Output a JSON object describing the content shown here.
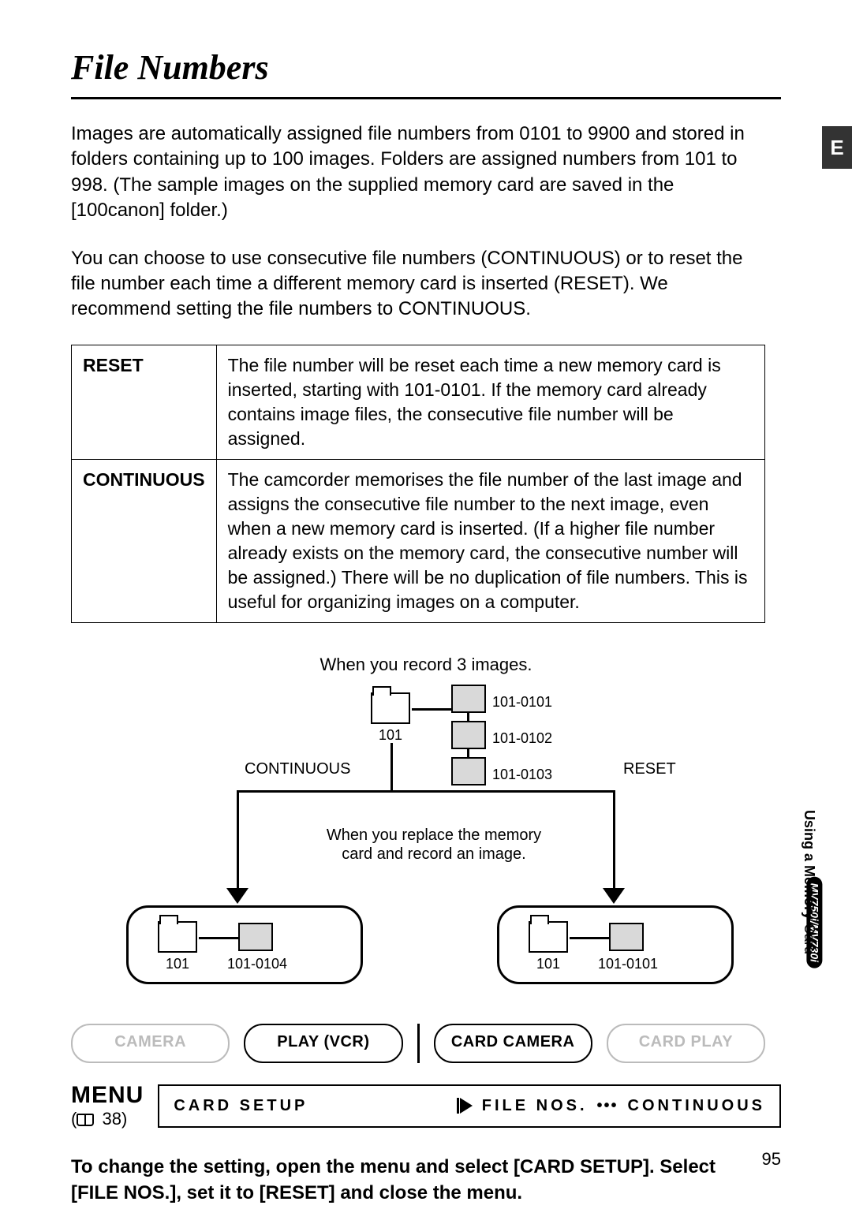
{
  "page": {
    "title": "File Numbers",
    "side_tab": "E",
    "page_number": "95",
    "side_section_bold": "Using a Memory ",
    "side_section_rest": "Card",
    "model_badge": "MV750i/MV730i"
  },
  "paragraphs": {
    "p1": "Images are automatically assigned file numbers from 0101 to 9900 and stored in folders containing up to 100 images. Folders are assigned numbers from 101 to 998. (The sample images on the supplied memory card are saved in the [100canon] folder.)",
    "p2": "You can choose to use consecutive file numbers (CONTINUOUS) or to reset the file number each time a different memory card is inserted (RESET). We recommend setting the file numbers to CONTINUOUS."
  },
  "table": {
    "row1_label": "RESET",
    "row1_text": "The file number will be reset each time a new memory card is inserted, starting with 101-0101. If the memory card already contains image files, the consecutive file number will be assigned.",
    "row2_label": "CONTINUOUS",
    "row2_text": "The camcorder memorises the file number of the last image and assigns the consecutive file number to the next image, even when a new memory card is inserted. (If a higher file number already exists on the memory card, the consecutive number will be assigned.) There will be no duplication of file numbers. This is useful for organizing images on a computer."
  },
  "diagram": {
    "caption1": "When you record 3 images.",
    "folder_101": "101",
    "file_1": "101-0101",
    "file_2": "101-0102",
    "file_3": "101-0103",
    "label_continuous": "CONTINUOUS",
    "label_reset": "RESET",
    "caption2a": "When you replace the memory",
    "caption2b": "card and record an image.",
    "left_folder": "101",
    "left_file": "101-0104",
    "right_folder": "101",
    "right_file": "101-0101"
  },
  "modes": {
    "m1": "CAMERA",
    "m2": "PLAY (VCR)",
    "m3": "CARD CAMERA",
    "m4": "CARD PLAY"
  },
  "menu": {
    "label": "MENU",
    "ref": "38",
    "left": "CARD SETUP",
    "right_key": "FILE NOS.",
    "right_dots": "•••",
    "right_val": "CONTINUOUS"
  },
  "instruction": "To change the setting, open the menu and select [CARD SETUP]. Select [FILE NOS.], set it to [RESET] and close the menu."
}
